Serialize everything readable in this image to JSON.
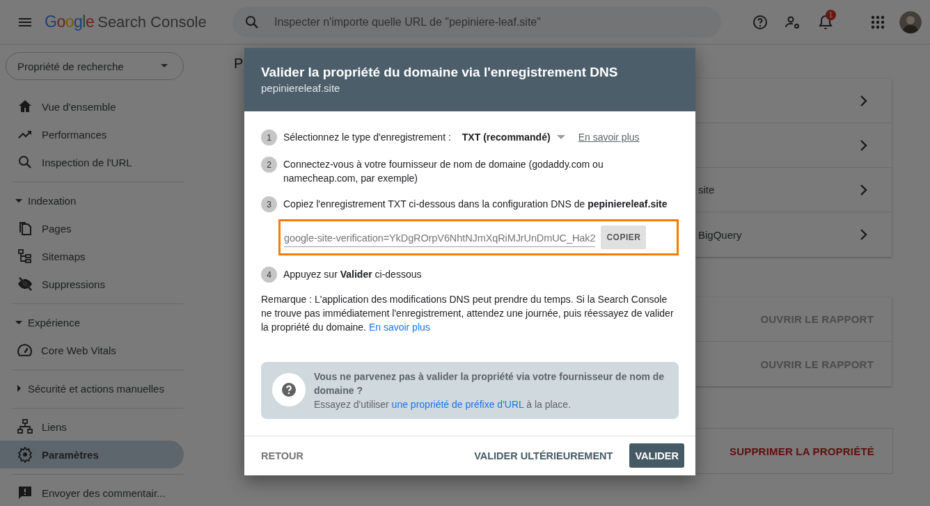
{
  "header": {
    "product_google": "Google",
    "product_name": "Search Console",
    "search": {
      "placeholder": "Inspecter n'importe quelle URL de \"pepiniere-leaf.site\""
    },
    "notification_count": "1"
  },
  "sidebar": {
    "property_selector": "Propriété de recherche",
    "groups": [
      {
        "kind": "links",
        "items": [
          {
            "label": "Vue d'ensemble",
            "selected": false
          },
          {
            "label": "Performances",
            "selected": false
          },
          {
            "label": "Inspection de l'URL",
            "selected": false
          }
        ]
      },
      {
        "kind": "section",
        "label": "Indexation",
        "expanded": true,
        "children": [
          {
            "label": "Pages",
            "selected": false
          },
          {
            "label": "Sitemaps",
            "selected": false
          },
          {
            "label": "Suppressions",
            "selected": false
          }
        ]
      },
      {
        "kind": "section",
        "label": "Expérience",
        "expanded": true,
        "children": [
          {
            "label": "Core Web Vitals",
            "selected": false
          }
        ]
      },
      {
        "kind": "section",
        "label": "Sécurité et actions manuelles",
        "expanded": false
      },
      {
        "kind": "links",
        "items": [
          {
            "label": "Liens",
            "selected": false
          },
          {
            "label": "Paramètres",
            "selected": true
          }
        ]
      },
      {
        "kind": "links",
        "items": [
          {
            "label": "Envoyer des commentair...",
            "selected": false
          }
        ]
      }
    ]
  },
  "main": {
    "page_title": "P",
    "cards": [
      {
        "kind": "links",
        "rows": [
          {
            "kind": "link"
          },
          {
            "kind": "link"
          },
          {
            "kind": "link",
            "label": "site"
          },
          {
            "kind": "link",
            "label": "BigQuery"
          }
        ]
      },
      {
        "kind": "reports",
        "rows": [
          {
            "kind": "action",
            "action": "OUVRIR LE RAPPORT"
          },
          {
            "kind": "action",
            "action": "OUVRIR LE RAPPORT"
          }
        ]
      },
      {
        "kind": "danger",
        "rows": [
          {
            "kind": "danger",
            "action": "SUPPRIMER LA PROPRIÉTÉ"
          }
        ]
      }
    ]
  },
  "dialog": {
    "title": "Valider la propriété du domaine via l'enregistrement DNS",
    "subtitle": "pepiniereleaf.site",
    "steps": [
      {
        "number": "1",
        "kind": "select",
        "text": "Sélectionnez le type d'enregistrement :",
        "select": "TXT (recommandé)",
        "link": "En savoir plus"
      },
      {
        "number": "2",
        "kind": "text",
        "text": "Connectez-vous à votre fournisseur de nom de domaine (godaddy.com ou namecheap.com, par exemple)"
      },
      {
        "number": "3",
        "kind": "record",
        "text": "Copiez l'enregistrement TXT ci-dessous dans la configuration DNS de **pepiniereleaf.site**",
        "record": {
          "value": "google-site-verification=YkDgROrpV6NhtNJmXqRiMJrUnDmUC_Hak2",
          "button": "COPIER",
          "highlighted": true
        }
      },
      {
        "number": "4",
        "kind": "text",
        "text": "Appuyez sur **Valider** ci-dessous"
      }
    ],
    "note": {
      "text": "Remarque : L'application des modifications DNS peut prendre du temps. Si la Search Console ne trouve pas immédiatement l'enregistrement, attendez une journée, puis réessayez de valider la propriété du domaine.",
      "link": "En savoir plus"
    },
    "help": {
      "title": "Vous ne parvenez pas à valider la propriété via votre fournisseur de nom de domaine ?",
      "text_before": "Essayez d'utiliser",
      "link": "une propriété de préfixe d'URL",
      "text_after": "à la place."
    },
    "buttons": [
      {
        "kind": "back",
        "label": "RETOUR"
      },
      {
        "kind": "later",
        "label": "VALIDER ULTÉRIEUREMENT"
      },
      {
        "kind": "primary",
        "label": "VALIDER"
      }
    ]
  }
}
